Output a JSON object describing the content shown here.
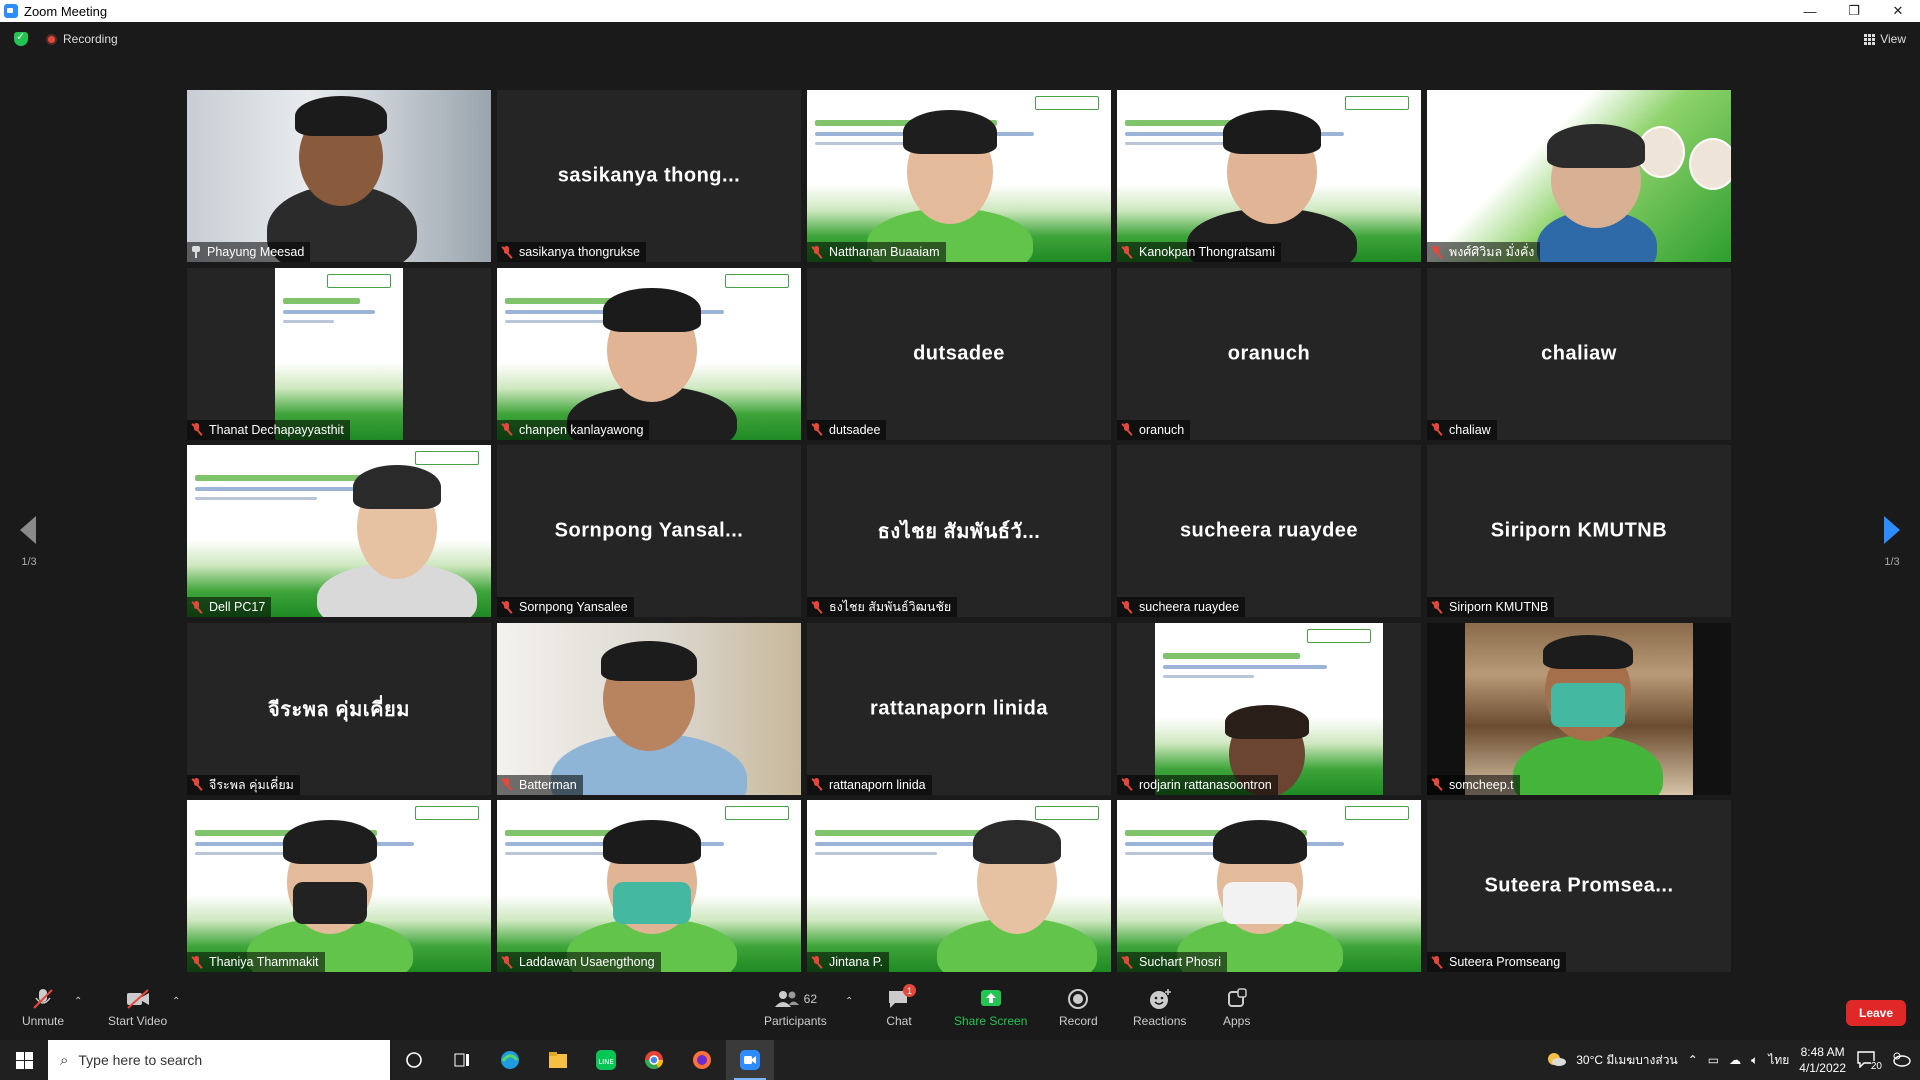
{
  "window": {
    "title": "Zoom Meeting",
    "minimize": "—",
    "maximize": "❐",
    "close": "✕"
  },
  "topbar": {
    "recording_label": "Recording",
    "view_label": "View"
  },
  "participants_tiles": [
    {
      "name": "Phayung Meesad",
      "center": "",
      "video": "building",
      "muted": false,
      "active": true
    },
    {
      "name": "sasikanya thongrukse",
      "center": "sasikanya  thong...",
      "video": "none",
      "muted": true,
      "active": false
    },
    {
      "name": "Natthanan Buaaiam",
      "center": "",
      "video": "slide-person",
      "muted": true,
      "active": false
    },
    {
      "name": "Kanokpan Thongratsami",
      "center": "",
      "video": "slide-person",
      "muted": true,
      "active": false
    },
    {
      "name": "พงศ์ศิวิมล มั่งคั่ง",
      "center": "",
      "video": "poster-person",
      "muted": true,
      "active": false
    },
    {
      "name": "Thanat Dechapayyasthit",
      "center": "",
      "video": "slide-narrow",
      "muted": true,
      "active": false
    },
    {
      "name": "chanpen kanlayawong",
      "center": "",
      "video": "slide-person",
      "muted": true,
      "active": false
    },
    {
      "name": "dutsadee",
      "center": "dutsadee",
      "video": "none",
      "muted": true,
      "active": false
    },
    {
      "name": "oranuch",
      "center": "oranuch",
      "video": "none",
      "muted": true,
      "active": false
    },
    {
      "name": "chaliaw",
      "center": "chaliaw",
      "video": "none",
      "muted": true,
      "active": false
    },
    {
      "name": "Dell PC17",
      "center": "",
      "video": "slide-person",
      "muted": true,
      "active": false
    },
    {
      "name": "Sornpong Yansalee",
      "center": "Sornpong  Yansal...",
      "video": "none",
      "muted": true,
      "active": false
    },
    {
      "name": "ธงไชย   สัมพันธ์วิฒนชัย",
      "center": "ธงไชย  สัมพันธ์วั...",
      "video": "none",
      "muted": true,
      "active": false
    },
    {
      "name": "sucheera ruaydee",
      "center": "sucheera ruaydee",
      "video": "none",
      "muted": true,
      "active": false
    },
    {
      "name": "Siriporn KMUTNB",
      "center": "Siriporn KMUTNB",
      "video": "none",
      "muted": true,
      "active": false
    },
    {
      "name": "จีระพล   คุ่มเคี่ยม",
      "center": "จีระพล  คุ่มเคี่ยม",
      "video": "none",
      "muted": true,
      "active": false
    },
    {
      "name": "Batterman",
      "center": "",
      "video": "room-person",
      "muted": true,
      "active": false
    },
    {
      "name": "rattanaporn linida",
      "center": "rattanaporn linida",
      "video": "none",
      "muted": true,
      "active": false
    },
    {
      "name": "rodjarin rattanasoontron",
      "center": "",
      "video": "slide-narrow-person",
      "muted": true,
      "active": false
    },
    {
      "name": "somcheep.t",
      "center": "",
      "video": "bookshelf-person",
      "muted": true,
      "active": false
    },
    {
      "name": "Thaniya Thammakit",
      "center": "",
      "video": "slide-person",
      "muted": true,
      "active": false
    },
    {
      "name": "Laddawan Usaengthong",
      "center": "",
      "video": "slide-person",
      "muted": true,
      "active": false
    },
    {
      "name": "Jintana P.",
      "center": "",
      "video": "slide-person",
      "muted": true,
      "active": false
    },
    {
      "name": "Suchart Phosri",
      "center": "",
      "video": "slide-person",
      "muted": true,
      "active": false
    },
    {
      "name": "Suteera Promseang",
      "center": "Suteera  Promsea...",
      "video": "none",
      "muted": true,
      "active": false
    }
  ],
  "pagination": {
    "left": "1/3",
    "right": "1/3"
  },
  "toolbar": {
    "unmute": "Unmute",
    "start_video": "Start Video",
    "participants": "Participants",
    "participant_count": "62",
    "chat": "Chat",
    "chat_badge": "1",
    "share_screen": "Share Screen",
    "record": "Record",
    "reactions": "Reactions",
    "apps": "Apps",
    "leave": "Leave"
  },
  "taskbar": {
    "search_placeholder": "Type here to search",
    "weather": "30°C  มีเมฆบางส่วน",
    "language": "ไทย",
    "time": "8:48 AM",
    "date": "4/1/2022",
    "notifications": "20"
  },
  "colors": {
    "accent": "#2d8cff",
    "leave": "#e02828",
    "muted": "#e5483b",
    "share": "#23c552",
    "active_speaker": "#f2f25a"
  }
}
